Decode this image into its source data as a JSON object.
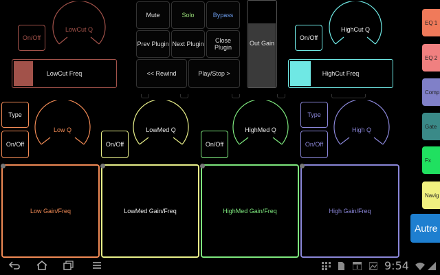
{
  "colors": {
    "lowcut": "#a2524a",
    "highcut": "#6fe8e4",
    "low": "#f08a55",
    "lowmed": "#e9f08a",
    "highmed": "#7ee87e",
    "high": "#8a86d8",
    "center_btn_border": "#3a3a3a",
    "side_eq1": "#f07a5a",
    "side_eq2": "#f08080",
    "side_comp": "#8080c8",
    "side_gate": "#3a8a88",
    "side_fx": "#20e060",
    "side_navig": "#f0f080",
    "autre": "#1e7fd0"
  },
  "lowcut": {
    "onoff": "On/Off",
    "q_label": "LowCut Q",
    "freq_label": "LowCut Freq",
    "freq_level": 0.08
  },
  "highcut": {
    "onoff": "On/Off",
    "q_label": "HighCut Q",
    "freq_label": "HighCut Freq",
    "freq_level": 0.1
  },
  "center": {
    "mute": "Mute",
    "solo": "Solo",
    "bypass": "Bypass",
    "prev_plugin": "Prev Plugin",
    "next_plugin": "Next Plugin",
    "close_plugin": "Close Plugin",
    "rewind": "<< Rewind",
    "play_stop": "Play/Stop >",
    "out_gain": "Out Gain",
    "out_gain_level": 0.74,
    "solo_color": "#9be07a",
    "bypass_color": "#6a9ae8"
  },
  "bands": [
    {
      "id": "low",
      "type": "Type",
      "onoff": "On/Off",
      "q": "Low Q",
      "pad": "Low Gain/Freq"
    },
    {
      "id": "lowmed",
      "onoff": "On/Off",
      "q": "LowMed Q",
      "pad": "LowMed Gain/Freq"
    },
    {
      "id": "highmed",
      "onoff": "On/Off",
      "q": "HighMed Q",
      "pad": "HighMed Gain/Freq"
    },
    {
      "id": "high",
      "type": "Type",
      "onoff": "On/Off",
      "q": "High Q",
      "pad": "High Gain/Freq"
    }
  ],
  "sidebar": {
    "eq1": "EQ 1",
    "eq2": "EQ 2",
    "comp": "Comp",
    "gate": "Gate",
    "fx": "Fx",
    "navig": "Navig",
    "autre": "Autre"
  },
  "navbar": {
    "back_icon": "back-arrow-icon",
    "home_icon": "home-icon",
    "recent_icon": "recent-apps-icon",
    "menu_icon": "menu-icon",
    "time": "9:54"
  }
}
